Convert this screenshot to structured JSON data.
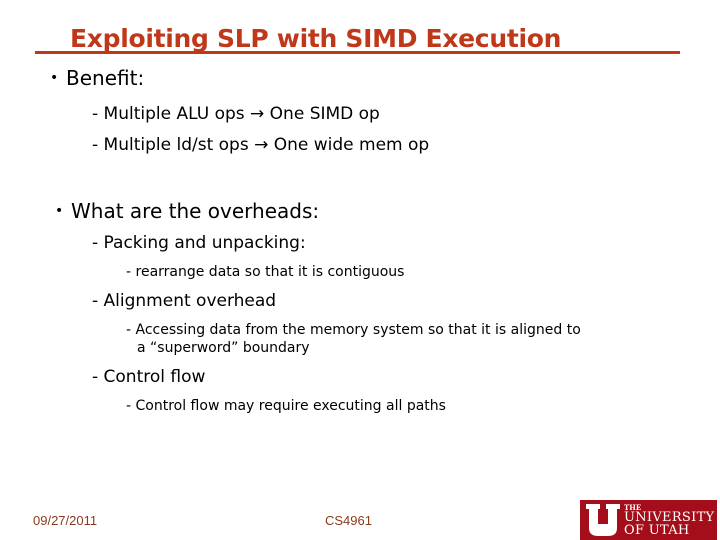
{
  "slide": {
    "title": "Exploiting SLP with SIMD Execution",
    "bullets": [
      {
        "text": "Benefit:",
        "subitems": [
          {
            "text": "- Multiple ALU ops → One SIMD op"
          },
          {
            "text": "- Multiple ld/st ops → One wide mem op"
          }
        ]
      },
      {
        "text": "What are the overheads:",
        "subitems": [
          {
            "text": "- Packing and unpacking:",
            "details": [
              "- rearrange data so that it is contiguous"
            ]
          },
          {
            "text": "- Alignment overhead",
            "details": [
              "- Accessing data from the memory system so that it is aligned to",
              "a “superword” boundary"
            ]
          },
          {
            "text": "- Control flow",
            "details": [
              "- Control flow may require executing all paths"
            ]
          }
        ]
      }
    ],
    "bullet_glyph": "•"
  },
  "footer": {
    "date": "09/27/2011",
    "course": "CS4961",
    "logo": {
      "the": "THE",
      "university": "UNIVERSITY",
      "of_utah": "OF UTAH",
      "color": "#a40e1a"
    }
  },
  "colors": {
    "title": "#c0381a",
    "footer_text": "#8b3a1e"
  }
}
